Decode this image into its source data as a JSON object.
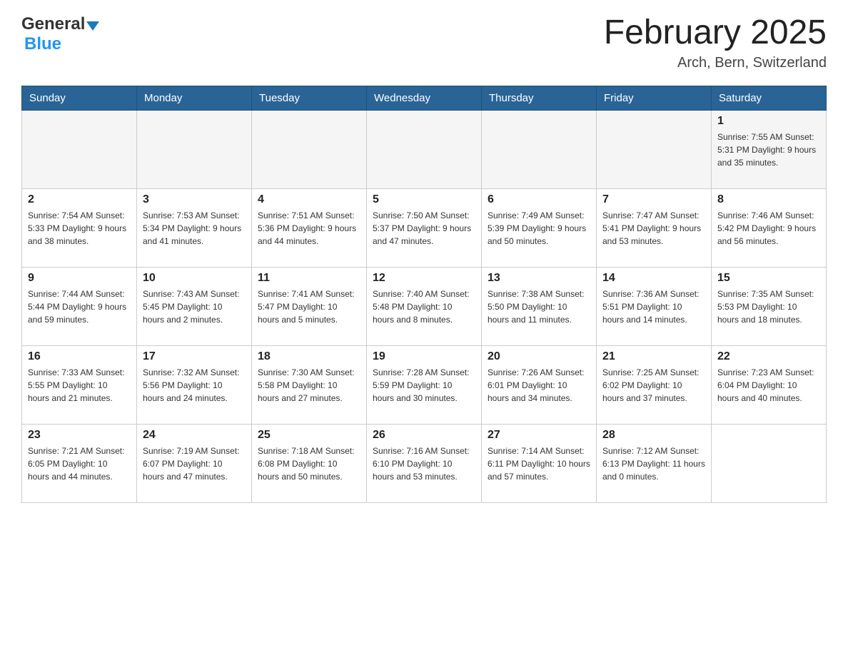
{
  "header": {
    "logo_general": "General",
    "logo_blue": "Blue",
    "month_title": "February 2025",
    "subtitle": "Arch, Bern, Switzerland"
  },
  "days_of_week": [
    "Sunday",
    "Monday",
    "Tuesday",
    "Wednesday",
    "Thursday",
    "Friday",
    "Saturday"
  ],
  "weeks": [
    {
      "days": [
        {
          "date": "",
          "info": ""
        },
        {
          "date": "",
          "info": ""
        },
        {
          "date": "",
          "info": ""
        },
        {
          "date": "",
          "info": ""
        },
        {
          "date": "",
          "info": ""
        },
        {
          "date": "",
          "info": ""
        },
        {
          "date": "1",
          "info": "Sunrise: 7:55 AM\nSunset: 5:31 PM\nDaylight: 9 hours and 35 minutes."
        }
      ]
    },
    {
      "days": [
        {
          "date": "2",
          "info": "Sunrise: 7:54 AM\nSunset: 5:33 PM\nDaylight: 9 hours and 38 minutes."
        },
        {
          "date": "3",
          "info": "Sunrise: 7:53 AM\nSunset: 5:34 PM\nDaylight: 9 hours and 41 minutes."
        },
        {
          "date": "4",
          "info": "Sunrise: 7:51 AM\nSunset: 5:36 PM\nDaylight: 9 hours and 44 minutes."
        },
        {
          "date": "5",
          "info": "Sunrise: 7:50 AM\nSunset: 5:37 PM\nDaylight: 9 hours and 47 minutes."
        },
        {
          "date": "6",
          "info": "Sunrise: 7:49 AM\nSunset: 5:39 PM\nDaylight: 9 hours and 50 minutes."
        },
        {
          "date": "7",
          "info": "Sunrise: 7:47 AM\nSunset: 5:41 PM\nDaylight: 9 hours and 53 minutes."
        },
        {
          "date": "8",
          "info": "Sunrise: 7:46 AM\nSunset: 5:42 PM\nDaylight: 9 hours and 56 minutes."
        }
      ]
    },
    {
      "days": [
        {
          "date": "9",
          "info": "Sunrise: 7:44 AM\nSunset: 5:44 PM\nDaylight: 9 hours and 59 minutes."
        },
        {
          "date": "10",
          "info": "Sunrise: 7:43 AM\nSunset: 5:45 PM\nDaylight: 10 hours and 2 minutes."
        },
        {
          "date": "11",
          "info": "Sunrise: 7:41 AM\nSunset: 5:47 PM\nDaylight: 10 hours and 5 minutes."
        },
        {
          "date": "12",
          "info": "Sunrise: 7:40 AM\nSunset: 5:48 PM\nDaylight: 10 hours and 8 minutes."
        },
        {
          "date": "13",
          "info": "Sunrise: 7:38 AM\nSunset: 5:50 PM\nDaylight: 10 hours and 11 minutes."
        },
        {
          "date": "14",
          "info": "Sunrise: 7:36 AM\nSunset: 5:51 PM\nDaylight: 10 hours and 14 minutes."
        },
        {
          "date": "15",
          "info": "Sunrise: 7:35 AM\nSunset: 5:53 PM\nDaylight: 10 hours and 18 minutes."
        }
      ]
    },
    {
      "days": [
        {
          "date": "16",
          "info": "Sunrise: 7:33 AM\nSunset: 5:55 PM\nDaylight: 10 hours and 21 minutes."
        },
        {
          "date": "17",
          "info": "Sunrise: 7:32 AM\nSunset: 5:56 PM\nDaylight: 10 hours and 24 minutes."
        },
        {
          "date": "18",
          "info": "Sunrise: 7:30 AM\nSunset: 5:58 PM\nDaylight: 10 hours and 27 minutes."
        },
        {
          "date": "19",
          "info": "Sunrise: 7:28 AM\nSunset: 5:59 PM\nDaylight: 10 hours and 30 minutes."
        },
        {
          "date": "20",
          "info": "Sunrise: 7:26 AM\nSunset: 6:01 PM\nDaylight: 10 hours and 34 minutes."
        },
        {
          "date": "21",
          "info": "Sunrise: 7:25 AM\nSunset: 6:02 PM\nDaylight: 10 hours and 37 minutes."
        },
        {
          "date": "22",
          "info": "Sunrise: 7:23 AM\nSunset: 6:04 PM\nDaylight: 10 hours and 40 minutes."
        }
      ]
    },
    {
      "days": [
        {
          "date": "23",
          "info": "Sunrise: 7:21 AM\nSunset: 6:05 PM\nDaylight: 10 hours and 44 minutes."
        },
        {
          "date": "24",
          "info": "Sunrise: 7:19 AM\nSunset: 6:07 PM\nDaylight: 10 hours and 47 minutes."
        },
        {
          "date": "25",
          "info": "Sunrise: 7:18 AM\nSunset: 6:08 PM\nDaylight: 10 hours and 50 minutes."
        },
        {
          "date": "26",
          "info": "Sunrise: 7:16 AM\nSunset: 6:10 PM\nDaylight: 10 hours and 53 minutes."
        },
        {
          "date": "27",
          "info": "Sunrise: 7:14 AM\nSunset: 6:11 PM\nDaylight: 10 hours and 57 minutes."
        },
        {
          "date": "28",
          "info": "Sunrise: 7:12 AM\nSunset: 6:13 PM\nDaylight: 11 hours and 0 minutes."
        },
        {
          "date": "",
          "info": ""
        }
      ]
    }
  ]
}
